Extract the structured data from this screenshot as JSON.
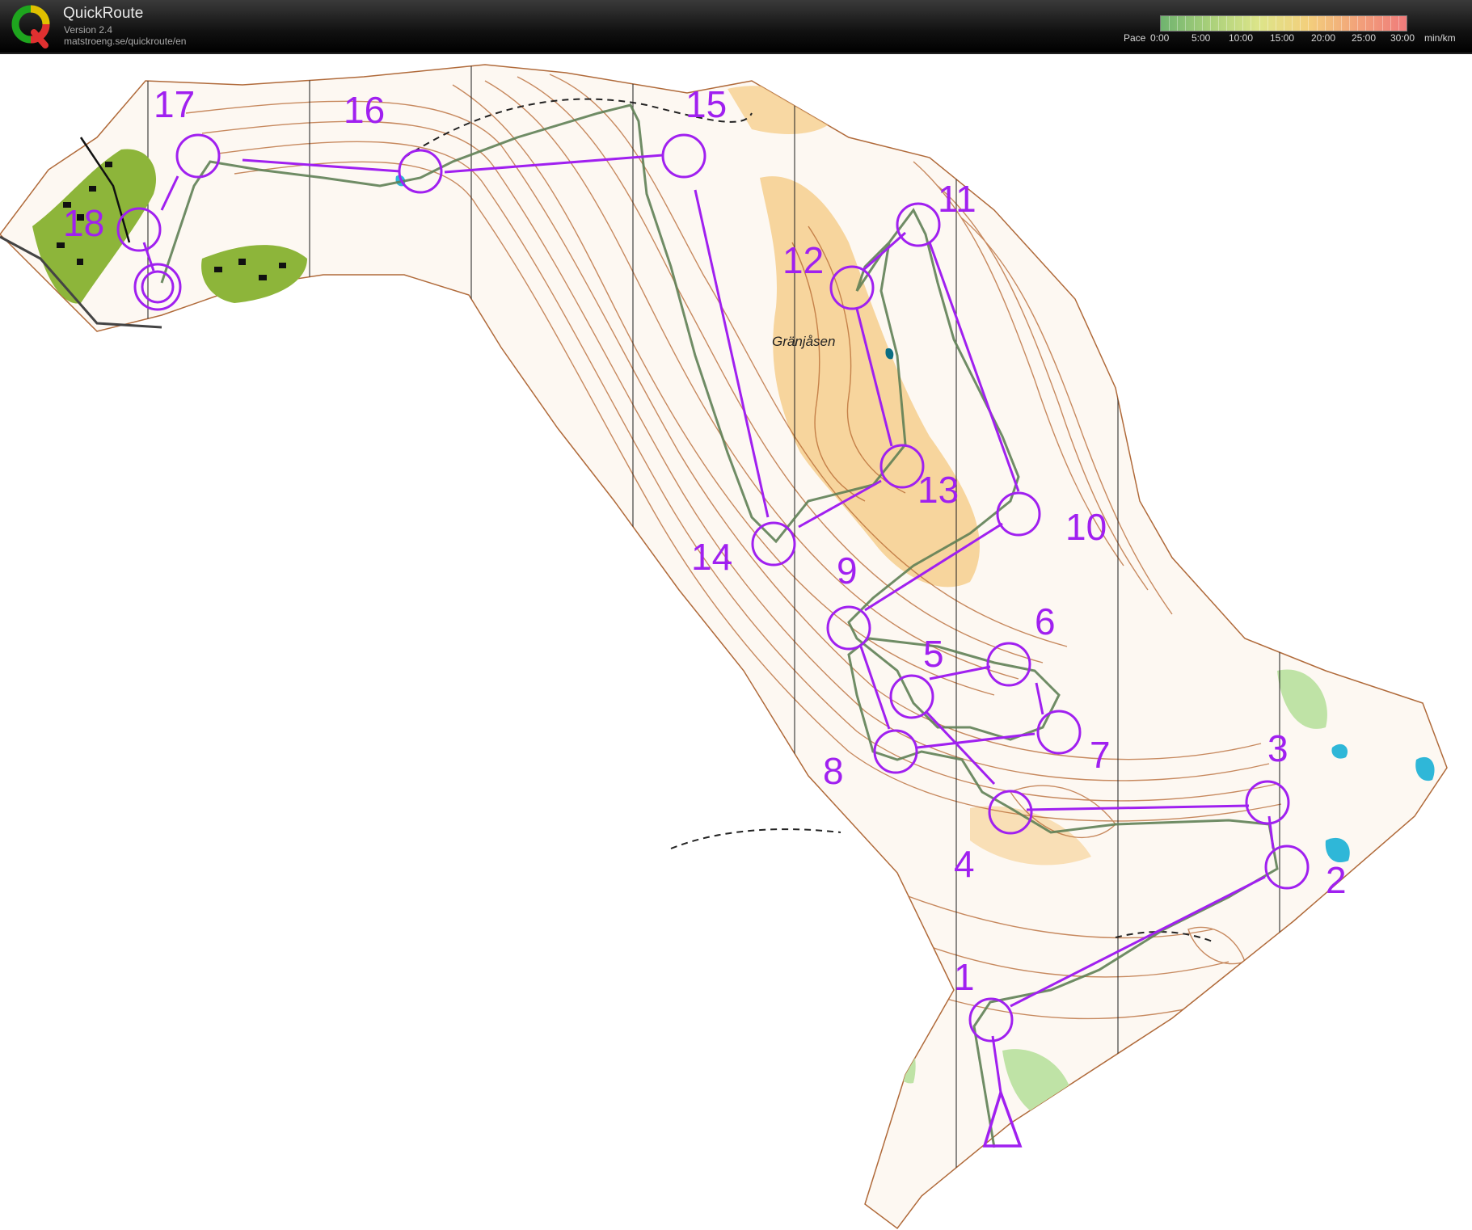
{
  "header": {
    "app_name": "QuickRoute",
    "version": "Version 2.4",
    "url": "matstroeng.se/quickroute/en",
    "logo_letter": "Q"
  },
  "pace_legend": {
    "label": "Pace",
    "ticks": [
      "0:00",
      "5:00",
      "10:00",
      "15:00",
      "20:00",
      "25:00",
      "30:00"
    ],
    "unit": "min/km",
    "colors": [
      "#6fb36f",
      "#a9d07a",
      "#dde58a",
      "#f3cf7c",
      "#f2a27a",
      "#ef7b7b"
    ]
  },
  "map": {
    "place_name": "Gränjåsen",
    "course_color": "#a020f0",
    "controls": [
      "1",
      "2",
      "3",
      "4",
      "5",
      "6",
      "7",
      "8",
      "9",
      "10",
      "11",
      "12",
      "13",
      "14",
      "15",
      "16",
      "17",
      "18"
    ]
  }
}
